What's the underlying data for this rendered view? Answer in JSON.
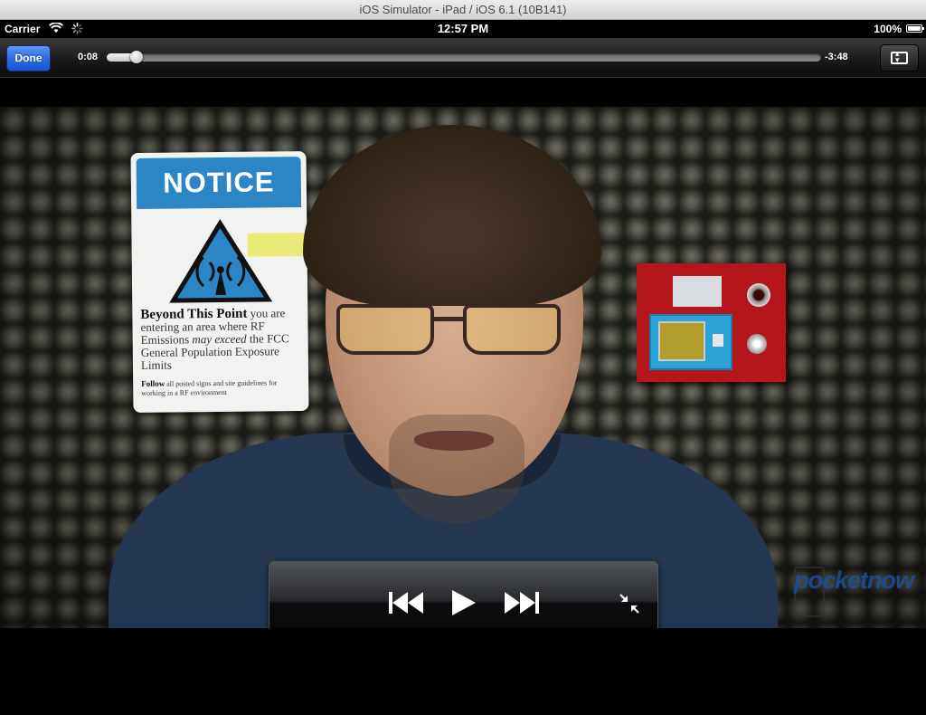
{
  "simulator": {
    "title": "iOS Simulator - iPad / iOS 6.1 (10B141)"
  },
  "status_bar": {
    "carrier": "Carrier",
    "time": "12:57 PM",
    "battery": "100%"
  },
  "toolbar": {
    "done_label": "Done",
    "elapsed": "0:08",
    "remaining": "-3:48",
    "progress_fraction": 0.042
  },
  "video": {
    "notice_sign": {
      "header": "NOTICE",
      "line1_bold": "Beyond This Point",
      "line1_rest": " you are entering an area where RF Emissions ",
      "line1_italic": "may exceed",
      "line1_tail": " the FCC General Population Exposure Limits",
      "small_bold": "Follow",
      "small_rest": " all posted signs and site guidelines for working in a RF environment"
    },
    "watermark": "pocketnow"
  },
  "controls": {
    "previous": "skip-back-icon",
    "play": "play-icon",
    "next": "skip-forward-icon",
    "exit_fullscreen": "exit-fullscreen-icon"
  },
  "colors": {
    "done_button": "#2d6be0",
    "notice_blue": "#2c86c5",
    "shirt": "#243650"
  }
}
